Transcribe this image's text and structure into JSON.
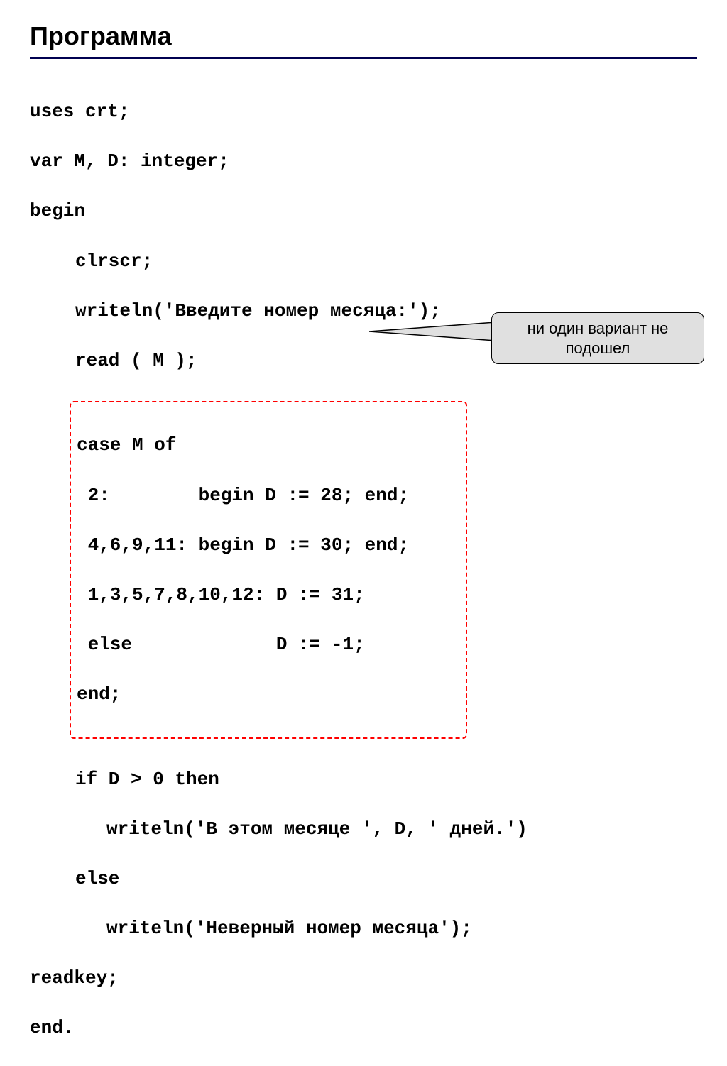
{
  "title": "Программа",
  "code": {
    "l1": "uses crt;",
    "l2": "var M, D: integer;",
    "l3": "begin",
    "l4": "clrscr;",
    "l5": "writeln('Введите номер месяца:');",
    "l6": "read ( M );",
    "box": {
      "b1": "case M of",
      "b2": " 2:        begin D := 28; end;",
      "b3": " 4,6,9,11: begin D := 30; end;",
      "b4": " 1,3,5,7,8,10,12: D := 31;",
      "b5": " else             D := -1;",
      "b6": "end;"
    },
    "l7": "if D > 0 then",
    "l8": "writeln('В этом месяце ', D, ' дней.')",
    "l9": "else",
    "l10": "writeln('Неверный номер месяца');",
    "l11": "readkey;",
    "l12": "end."
  },
  "callout": "ни один вариант не подошел"
}
